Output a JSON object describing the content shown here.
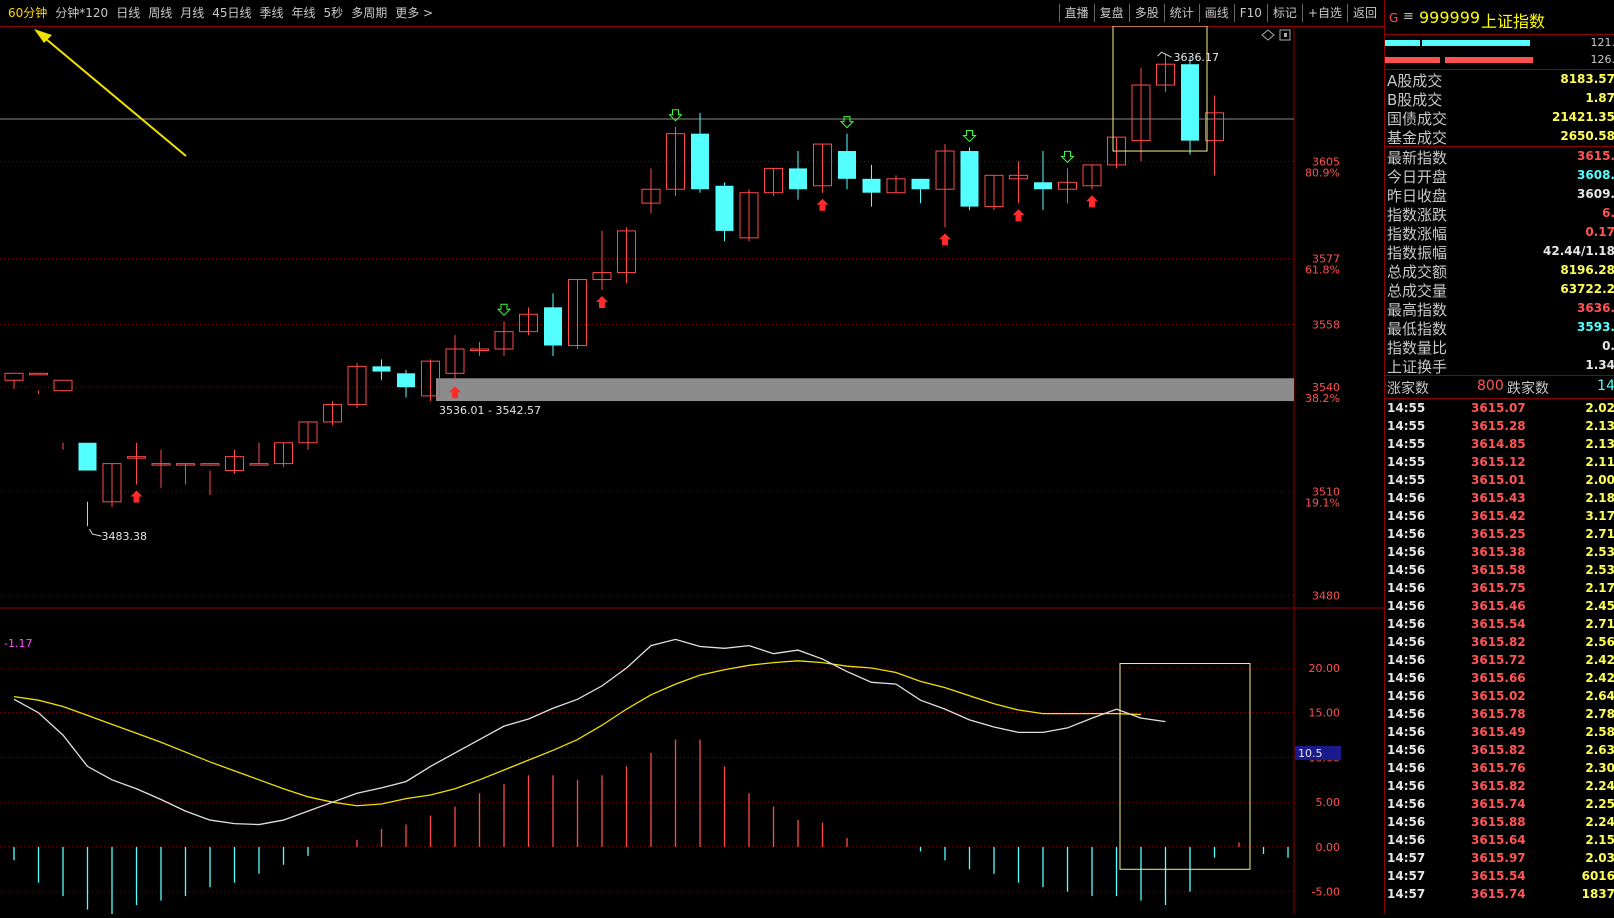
{
  "toolbar": {
    "periods": [
      "60分钟",
      "分钟*120",
      "日线",
      "周线",
      "月线",
      "45日线",
      "季线",
      "年线",
      "5秒",
      "多周期",
      "更多 >"
    ],
    "active_period": "60分钟",
    "tools": [
      "直播",
      "复盘",
      "多股",
      "统计",
      "画线",
      "F10",
      "标记",
      "+自选",
      "返回"
    ]
  },
  "colors": {
    "up": "#ff4a4a",
    "down": "#54ffff",
    "ma_white": "#e0e0e0",
    "ma_yellow": "#f0e000",
    "grid": "#8b0000",
    "highlight": "#f2f08c"
  },
  "chart_data": [
    {
      "type": "candlestick",
      "title": "",
      "y_ticks": [
        {
          "value": 3605,
          "label": "3605",
          "pct": "80.9%"
        },
        {
          "value": 3577,
          "label": "3577",
          "pct": "61.8%"
        },
        {
          "value": 3558,
          "label": "3558",
          "pct": ""
        },
        {
          "value": 3540,
          "label": "3540",
          "pct": "38.2%"
        },
        {
          "value": 3510,
          "label": "3510",
          "pct": "19.1%"
        },
        {
          "value": 3480,
          "label": "3480",
          "pct": ""
        }
      ],
      "ylim": [
        3477,
        3644
      ],
      "candles": [
        [
          3542.0,
          3544.0,
          3539.5,
          3542.0
        ],
        [
          3544.0,
          3544.0,
          3538.0,
          3539.0
        ],
        [
          3539.0,
          3542.0,
          3522.0,
          3524.0
        ],
        [
          3524.0,
          3516.0,
          3500.0,
          3507.0
        ],
        [
          3507.0,
          3518.0,
          3505.5,
          3518.0
        ],
        [
          3520.0,
          3520.0,
          3512.0,
          3524.0
        ],
        [
          3518.0,
          3518.0,
          3511.0,
          3522.0
        ],
        [
          3518.0,
          3518.0,
          3512.0,
          3518.0
        ],
        [
          3518.0,
          3518.0,
          3509.0,
          3516.0
        ],
        [
          3516.0,
          3520.0,
          3515.0,
          3522.0
        ],
        [
          3518.0,
          3518.0,
          3518.0,
          3524.0
        ],
        [
          3518.0,
          3524.0,
          3517.0,
          3524.0
        ],
        [
          3524.0,
          3530.0,
          3522.0,
          3530.0
        ],
        [
          3530.0,
          3535.0,
          3529.0,
          3536.0
        ],
        [
          3535.0,
          3546.0,
          3534.0,
          3547.0
        ],
        [
          3546.0,
          3544.5,
          3542.0,
          3548.0
        ],
        [
          3544.0,
          3540.0,
          3537.0,
          3545.0
        ],
        [
          3537.5,
          3547.5,
          3536.0,
          3548.0
        ],
        [
          3544.0,
          3551.0,
          3542.0,
          3555.0
        ],
        [
          3551.0,
          3551.0,
          3549.0,
          3553.0
        ],
        [
          3551.0,
          3556.0,
          3549.0,
          3559.0
        ],
        [
          3556.0,
          3561.0,
          3555.0,
          3563.0
        ],
        [
          3563.0,
          3552.0,
          3549.0,
          3567.0
        ],
        [
          3552.0,
          3571.0,
          3551.0,
          3571.0
        ],
        [
          3571.0,
          3573.0,
          3568.0,
          3585.0
        ],
        [
          3573.0,
          3585.0,
          3570.0,
          3586.0
        ],
        [
          3593.0,
          3597.0,
          3590.0,
          3603.0
        ],
        [
          3597.0,
          3613.0,
          3595.0,
          3615.0
        ],
        [
          3613.0,
          3597.0,
          3596.0,
          3619.0
        ],
        [
          3598.0,
          3585.0,
          3582.0,
          3599.0
        ],
        [
          3583.0,
          3596.0,
          3582.0,
          3597.0
        ],
        [
          3596.0,
          3603.0,
          3595.0,
          3603.0
        ],
        [
          3603.0,
          3597.0,
          3594.0,
          3608.0
        ],
        [
          3598.0,
          3610.0,
          3596.0,
          3610.0
        ],
        [
          3608.0,
          3600.0,
          3597.0,
          3613.0
        ],
        [
          3600.0,
          3596.0,
          3592.0,
          3604.0
        ],
        [
          3596.0,
          3600.0,
          3596.0,
          3601.0
        ],
        [
          3600.0,
          3597.0,
          3593.0,
          3600.0
        ],
        [
          3597.0,
          3608.0,
          3586.0,
          3610.0
        ],
        [
          3608.0,
          3592.0,
          3591.0,
          3609.0
        ],
        [
          3592.0,
          3601.0,
          3591.0,
          3601.0
        ],
        [
          3600.0,
          3601.0,
          3593.0,
          3605.0
        ],
        [
          3599.0,
          3597.0,
          3591.0,
          3608.0
        ],
        [
          3597.0,
          3599.0,
          3593.0,
          3603.0
        ],
        [
          3598.0,
          3604.0,
          3597.0,
          3604.0
        ],
        [
          3604.0,
          3612.0,
          3603.0,
          3612.0
        ],
        [
          3611.0,
          3627.0,
          3605.0,
          3632.0
        ],
        [
          3627.0,
          3633.0,
          3625.0,
          3636.17
        ],
        [
          3633.0,
          3611.0,
          3607.0,
          3635.0
        ],
        [
          3611.0,
          3619.0,
          3601.0,
          3624.0
        ]
      ],
      "signals_down": [
        20,
        27,
        34,
        39,
        43
      ],
      "signals_up": [
        5,
        18,
        24,
        33,
        38,
        41,
        44
      ],
      "band": {
        "low": 3536.01,
        "high": 3542.57,
        "label": "3536.01 - 3542.57"
      },
      "high_label": "3636.17",
      "low_label": "3483.38"
    },
    {
      "type": "line",
      "title": "",
      "value_label": "-1.17",
      "current_value": "10.5",
      "y_ticks": [
        "20.00",
        "15.00",
        "10.00",
        "5.00",
        "0.00",
        "-5.00"
      ],
      "ylim": [
        -7.5,
        23.8
      ],
      "dif": [
        16.5,
        15.0,
        12.5,
        9.0,
        7.5,
        6.5,
        5.3,
        4.0,
        3.0,
        2.6,
        2.5,
        3.0,
        4.0,
        5.0,
        6.0,
        6.6,
        7.3,
        9.0,
        10.5,
        12.0,
        13.5,
        14.3,
        15.5,
        16.5,
        18.0,
        20.0,
        22.5,
        23.2,
        22.4,
        22.2,
        22.5,
        21.6,
        22.0,
        21.0,
        19.6,
        18.4,
        18.2,
        16.4,
        15.4,
        14.2,
        13.4,
        12.8,
        12.8,
        13.3,
        14.4,
        15.4,
        14.4,
        14.0
      ],
      "dea": [
        16.8,
        16.4,
        15.7,
        14.7,
        13.7,
        12.7,
        11.7,
        10.6,
        9.5,
        8.5,
        7.5,
        6.5,
        5.6,
        5.0,
        4.6,
        4.8,
        5.4,
        5.8,
        6.5,
        7.5,
        8.6,
        9.7,
        10.8,
        12.0,
        13.6,
        15.4,
        17.0,
        18.2,
        19.2,
        19.8,
        20.3,
        20.6,
        20.8,
        20.6,
        20.2,
        20.0,
        19.5,
        18.5,
        17.8,
        16.9,
        16.0,
        15.3,
        14.9,
        14.9,
        14.9,
        14.9,
        14.8
      ],
      "macd": [
        -1.5,
        -4.0,
        -5.5,
        -7.0,
        -7.5,
        -6.5,
        -6.0,
        -5.5,
        -4.5,
        -4.0,
        -3.0,
        -2.0,
        -1.0,
        0.0,
        0.8,
        2.0,
        2.5,
        3.5,
        4.5,
        6.0,
        7.0,
        8.0,
        8.0,
        7.5,
        8.0,
        9.0,
        10.5,
        12.0,
        12.0,
        9.0,
        6.0,
        4.5,
        3.0,
        2.7,
        1.0,
        0.0,
        0.0,
        -0.5,
        -1.5,
        -2.5,
        -3.0,
        -4.0,
        -4.5,
        -5.0,
        -5.5,
        -5.5,
        -6.0,
        -6.5,
        -5.0,
        -1.2,
        0.5,
        -0.8,
        -1.2
      ]
    }
  ],
  "panel": {
    "g_label": "G",
    "code": "999999",
    "name": "上证指数",
    "bar_values": [
      "121.",
      "126."
    ],
    "stats_top": [
      {
        "label": "A股成交",
        "value": "8183.57"
      },
      {
        "label": "B股成交",
        "value": "1.87"
      },
      {
        "label": "国债成交",
        "value": "21421.35"
      },
      {
        "label": "基金成交",
        "value": "2650.58"
      }
    ],
    "stats_main": [
      {
        "label": "最新指数",
        "value": "3615.",
        "color": "#ff5555"
      },
      {
        "label": "今日开盘",
        "value": "3608.",
        "color": "#54ffff"
      },
      {
        "label": "昨日收盘",
        "value": "3609.",
        "color": "#e6e6e6"
      },
      {
        "label": "指数涨跌",
        "value": "6.",
        "color": "#ff5555"
      },
      {
        "label": "指数涨幅",
        "value": "0.17",
        "color": "#ff5555"
      },
      {
        "label": "指数振幅",
        "value": "42.44/1.18",
        "color": "#e6e6e6"
      },
      {
        "label": "总成交额",
        "value": "8196.28",
        "color": "#ffff55"
      },
      {
        "label": "总成交量",
        "value": "63722.2",
        "color": "#ffff55"
      },
      {
        "label": "最高指数",
        "value": "3636.",
        "color": "#ff5555"
      },
      {
        "label": "最低指数",
        "value": "3593.",
        "color": "#54ffff"
      },
      {
        "label": "指数量比",
        "value": "0.",
        "color": "#e6e6e6"
      },
      {
        "label": "上证换手",
        "value": "1.34",
        "color": "#e6e6e6"
      }
    ],
    "updown": {
      "up_label": "涨家数",
      "up_count": "800",
      "down_label": "跌家数",
      "down_count": "14"
    },
    "ticks": [
      {
        "time": "14:55",
        "price": "3615.07",
        "vol": "2.02"
      },
      {
        "time": "14:55",
        "price": "3615.28",
        "vol": "2.13"
      },
      {
        "time": "14:55",
        "price": "3614.85",
        "vol": "2.13"
      },
      {
        "time": "14:55",
        "price": "3615.12",
        "vol": "2.11"
      },
      {
        "time": "14:55",
        "price": "3615.01",
        "vol": "2.00"
      },
      {
        "time": "14:56",
        "price": "3615.43",
        "vol": "2.18"
      },
      {
        "time": "14:56",
        "price": "3615.42",
        "vol": "3.17"
      },
      {
        "time": "14:56",
        "price": "3615.25",
        "vol": "2.71"
      },
      {
        "time": "14:56",
        "price": "3615.38",
        "vol": "2.53"
      },
      {
        "time": "14:56",
        "price": "3615.58",
        "vol": "2.53"
      },
      {
        "time": "14:56",
        "price": "3615.75",
        "vol": "2.17"
      },
      {
        "time": "14:56",
        "price": "3615.46",
        "vol": "2.45"
      },
      {
        "time": "14:56",
        "price": "3615.54",
        "vol": "2.71"
      },
      {
        "time": "14:56",
        "price": "3615.82",
        "vol": "2.56"
      },
      {
        "time": "14:56",
        "price": "3615.72",
        "vol": "2.42"
      },
      {
        "time": "14:56",
        "price": "3615.66",
        "vol": "2.42"
      },
      {
        "time": "14:56",
        "price": "3615.02",
        "vol": "2.64"
      },
      {
        "time": "14:56",
        "price": "3615.78",
        "vol": "2.78"
      },
      {
        "time": "14:56",
        "price": "3615.49",
        "vol": "2.58"
      },
      {
        "time": "14:56",
        "price": "3615.82",
        "vol": "2.63"
      },
      {
        "time": "14:56",
        "price": "3615.76",
        "vol": "2.30"
      },
      {
        "time": "14:56",
        "price": "3615.82",
        "vol": "2.24"
      },
      {
        "time": "14:56",
        "price": "3615.74",
        "vol": "2.25"
      },
      {
        "time": "14:56",
        "price": "3615.88",
        "vol": "2.24"
      },
      {
        "time": "14:56",
        "price": "3615.64",
        "vol": "2.15"
      },
      {
        "time": "14:57",
        "price": "3615.97",
        "vol": "2.03"
      },
      {
        "time": "14:57",
        "price": "3615.54",
        "vol": "6016"
      },
      {
        "time": "14:57",
        "price": "3615.74",
        "vol": "1837"
      }
    ]
  }
}
